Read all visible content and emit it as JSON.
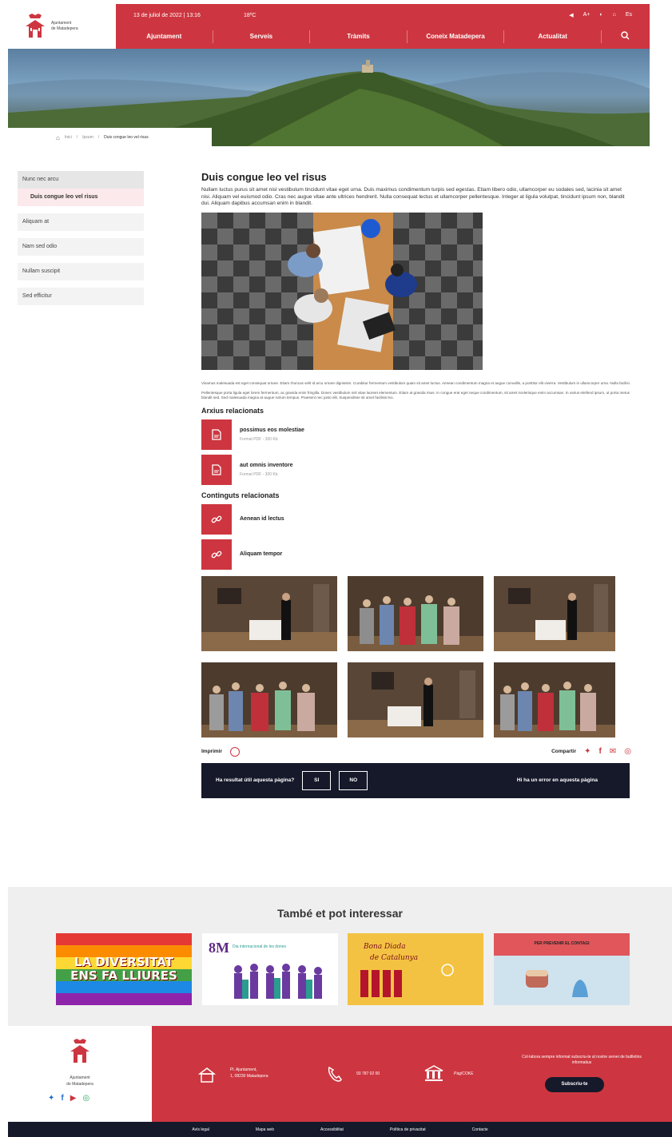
{
  "header": {
    "logo_line1": "Ajuntament",
    "logo_line2": "de Matadepera",
    "date": "13 de juliol de 2022 | 13:16",
    "temp": "18ºC",
    "tools": [
      "◀",
      "A+",
      "◐",
      "⌂",
      "Es"
    ],
    "nav": [
      "Ajuntament",
      "Serveis",
      "Tràmits",
      "Coneix Matadepera",
      "Actualitat"
    ],
    "search_icon": "search-icon"
  },
  "breadcrumb": {
    "items": [
      "Inici",
      "Ipsum"
    ],
    "current": "Duis congue leo vel risus"
  },
  "sidebar": {
    "items": [
      {
        "label": "Nunc nec arcu"
      },
      {
        "label": "Duis congue leo vel risus",
        "active_sub": true
      },
      {
        "label": "Aliquam at"
      },
      {
        "label": "Nam sed odio"
      },
      {
        "label": "Nullam suscipit"
      },
      {
        "label": "Sed efficitur"
      }
    ]
  },
  "main": {
    "title": "Duis congue leo vel risus",
    "intro": "Nullam luctus purus sit amet nisl vestibulum tincidunt vitae eget urna. Duis maximus condimentum turpis sed egestas. Etiam libero odio, ullamcorper eu sodales sed, lacinia sit amet nisi. Aliquam vel euismod odio. Cras nec augue vitae ante ultrices hendrerit. Nulla consequat lectus et ullamcorper pellentesque. Integer at ligula volutpat, tincidunt ipsum non, blandit dui. Aliquam dapibus accumsan enim in blandit.",
    "para1": "Vivamus malesuada est eget consequat ornare. Etiam rhoncus velit id arcu ornare dignissim. Curabitur fermentum vestibulum quam sit amet luctus. Aenean condimentum magna et augue convallis, a porttitor elit viverra. Vestibulum in ullamcorper urna. Nulla facilisi.",
    "para2": "Pellentesque porta ligula eget lorem fermentum, ac gravida enim fringilla. Donec vestibulum nisl vitae laoreet elementum. Etiam at gravida risus. In congue erat eget neque condimentum, sit amet scelerisque enim accumsan. In varius eleifend ipsum, ut porta metus blandit sed. Sed malesuada magna at augue rutrum tempus. Praesent nec justo elit. Suspendisse sit amet facilisis leo.",
    "files_title": "Arxius relacionats",
    "files": [
      {
        "name": "possimus eos molestiae",
        "meta": "Format PDF - 300 Kb"
      },
      {
        "name": "aut omnis inventore",
        "meta": "Format PDF - 300 Kb"
      }
    ],
    "content_title": "Continguts relacionats",
    "contents": [
      {
        "name": "Aenean id lectus"
      },
      {
        "name": "Aliquam tempor"
      }
    ],
    "print_label": "Imprimir",
    "share_label": "Compartir",
    "feedback": {
      "question": "Ha resultat útil aquesta pàgina?",
      "yes": "SI",
      "no": "NO",
      "error": "Hi ha un error en aquesta pàgina"
    }
  },
  "interest": {
    "title": "També et pot interessar",
    "promos": [
      {
        "line1": "LA DIVERSITAT",
        "line2": "ENS FA LLIURES"
      },
      {
        "line1": "8M",
        "line2": "Dia internacional de les dones"
      },
      {
        "line1": "Bona Diada",
        "line2": "de Catalunya"
      },
      {
        "line1": "PER PREVENIR EL CONTAGI"
      }
    ]
  },
  "footer": {
    "logo_line1": "Ajuntament",
    "logo_line2": "de Matadepera",
    "address_line1": "Pl. Ajuntament,",
    "address_line2": "1, 08230 Matadepera",
    "phone": "93 787 02 00",
    "bank": "Pàg/COKE",
    "newsletter_text": "Col·labora sempre informat subscriu-te al nostre servei de butlletins informatius",
    "subscribe": "Subscriu-te",
    "bottom_links": [
      "Avís legal",
      "Mapa web",
      "Accessibilitat",
      "Política de privacitat",
      "Contacte"
    ]
  },
  "colors": {
    "brand_red": "#cd3640",
    "dark": "#15192a"
  }
}
